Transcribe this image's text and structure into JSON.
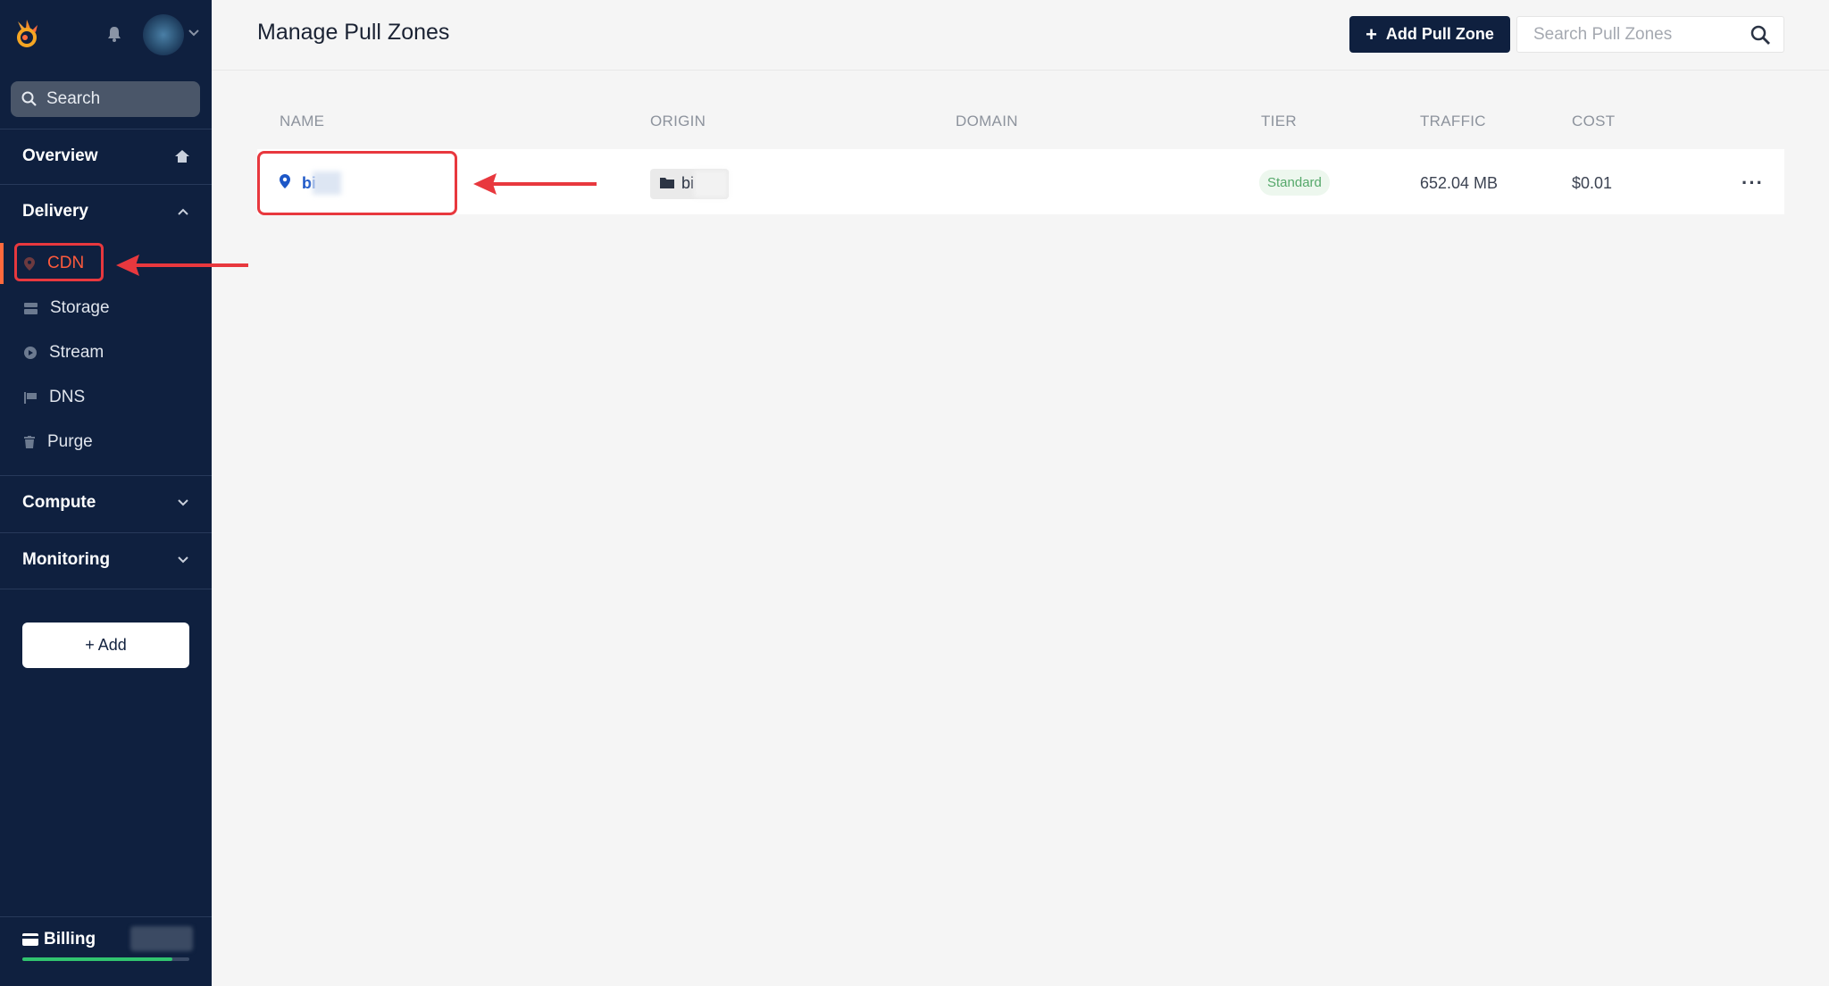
{
  "sidebar": {
    "search_label": "Search",
    "sections": {
      "overview": "Overview",
      "delivery": "Delivery",
      "compute": "Compute",
      "monitoring": "Monitoring"
    },
    "delivery_items": [
      {
        "label": "CDN",
        "icon": "map-pin-icon",
        "active": true
      },
      {
        "label": "Storage",
        "icon": "storage-icon"
      },
      {
        "label": "Stream",
        "icon": "play-icon"
      },
      {
        "label": "DNS",
        "icon": "flag-icon"
      },
      {
        "label": "Purge",
        "icon": "trash-icon"
      }
    ],
    "add_label": "+ Add",
    "billing_label": "Billing",
    "billing_progress": 0.9
  },
  "header": {
    "title": "Manage Pull Zones",
    "add_button": "Add Pull Zone",
    "search_placeholder": "Search Pull Zones"
  },
  "table": {
    "columns": [
      "NAME",
      "ORIGIN",
      "DOMAIN",
      "TIER",
      "TRAFFIC",
      "COST"
    ],
    "rows": [
      {
        "name": "bi",
        "origin": "bi",
        "domain": "",
        "tier": "Standard",
        "traffic": "652.04 MB",
        "cost": "$0.01"
      }
    ]
  },
  "colors": {
    "sidebar_bg": "#0f203f",
    "accent": "#ff5a3c",
    "annotation": "#e8383e",
    "primary_button": "#0f203f"
  }
}
